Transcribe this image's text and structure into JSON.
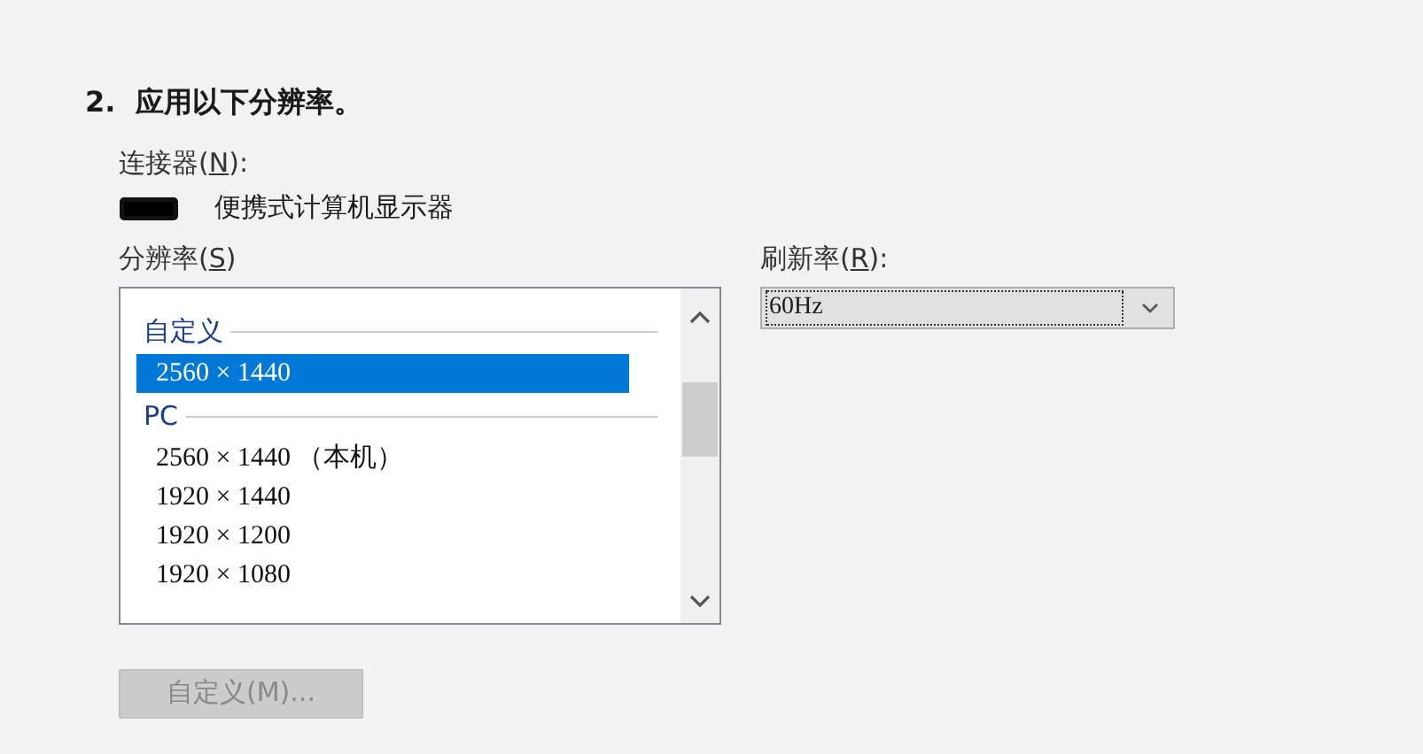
{
  "heading": "2.  应用以下分辨率。",
  "connector": {
    "label": {
      "before": "连接器(",
      "accesskey": "N",
      "after": "):"
    },
    "display": "便携式计算机显示器"
  },
  "resolution": {
    "label": {
      "before": "分辨率(",
      "accesskey": "S",
      "after": ")"
    },
    "items": [
      {
        "kind": "group",
        "text": "自定义"
      },
      {
        "kind": "item",
        "text": "2560 × 1440",
        "selected": true
      },
      {
        "kind": "group",
        "text": "PC"
      },
      {
        "kind": "item",
        "text": "2560 × 1440 （本机）",
        "selected": false
      },
      {
        "kind": "item",
        "text": "1920 × 1440",
        "selected": false
      },
      {
        "kind": "item",
        "text": "1920 × 1200",
        "selected": false
      },
      {
        "kind": "item",
        "text": "1920 × 1080",
        "selected": false
      }
    ]
  },
  "refresh": {
    "label": {
      "before": "刷新率(",
      "accesskey": "R",
      "after": "):"
    },
    "value": "60Hz"
  },
  "custom_button": {
    "label": "自定义(M)...",
    "disabled": true
  }
}
